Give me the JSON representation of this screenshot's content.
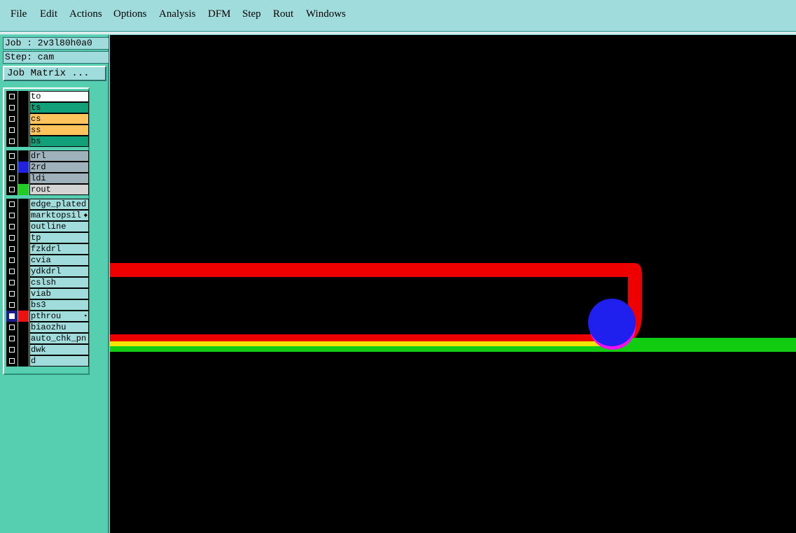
{
  "menu": [
    {
      "label": "File",
      "name": "menu-file"
    },
    {
      "label": "Edit",
      "name": "menu-edit"
    },
    {
      "label": "Actions",
      "name": "menu-actions"
    },
    {
      "label": "Options",
      "name": "menu-options"
    },
    {
      "label": "Analysis",
      "name": "menu-analysis"
    },
    {
      "label": "DFM",
      "name": "menu-dfm"
    },
    {
      "label": "Step",
      "name": "menu-step"
    },
    {
      "label": "Rout",
      "name": "menu-rout"
    },
    {
      "label": "Windows",
      "name": "menu-windows"
    }
  ],
  "job": {
    "job_text": "Job : 2v3l80h0a0",
    "step_text": "Step: cam",
    "job_matrix_label": "Job Matrix ..."
  },
  "layers": [
    {
      "name": "to",
      "bg": "#ffffff",
      "swatch": "#000000",
      "active": false,
      "mark": ""
    },
    {
      "name": "ts",
      "bg": "#12a07a",
      "swatch": "#000000",
      "active": false,
      "mark": ""
    },
    {
      "name": "cs",
      "bg": "#ffc45c",
      "swatch": "#000000",
      "active": false,
      "mark": ""
    },
    {
      "name": "ss",
      "bg": "#ffc45c",
      "swatch": "#000000",
      "active": false,
      "mark": ""
    },
    {
      "name": "bs",
      "bg": "#12a07a",
      "swatch": "#000000",
      "active": false,
      "mark": ""
    },
    {
      "name": "drl",
      "bg": "#9fb2bc",
      "swatch": "#000000",
      "active": false,
      "mark": ""
    },
    {
      "name": "2rd",
      "bg": "#9fb2bc",
      "swatch": "#2222dd",
      "active": false,
      "mark": ""
    },
    {
      "name": "ldi",
      "bg": "#9fb2bc",
      "swatch": "#000000",
      "active": false,
      "mark": ""
    },
    {
      "name": "rout",
      "bg": "#d4d4d4",
      "swatch": "#22cc22",
      "active": false,
      "mark": ""
    },
    {
      "name": "edge_plated",
      "bg": "#a0dcdc",
      "swatch": "#000000",
      "active": false,
      "mark": ""
    },
    {
      "name": "marktopsil",
      "bg": "#a0dcdc",
      "swatch": "#000000",
      "active": false,
      "mark": "◆"
    },
    {
      "name": "outline",
      "bg": "#a0dcdc",
      "swatch": "#000000",
      "active": false,
      "mark": ""
    },
    {
      "name": "tp",
      "bg": "#a0dcdc",
      "swatch": "#000000",
      "active": false,
      "mark": ""
    },
    {
      "name": "fzkdrl",
      "bg": "#a0dcdc",
      "swatch": "#000000",
      "active": false,
      "mark": ""
    },
    {
      "name": "cvia",
      "bg": "#a0dcdc",
      "swatch": "#000000",
      "active": false,
      "mark": ""
    },
    {
      "name": "ydkdrl",
      "bg": "#a0dcdc",
      "swatch": "#000000",
      "active": false,
      "mark": ""
    },
    {
      "name": "cslsh",
      "bg": "#a0dcdc",
      "swatch": "#000000",
      "active": false,
      "mark": ""
    },
    {
      "name": "viab",
      "bg": "#a0dcdc",
      "swatch": "#000000",
      "active": false,
      "mark": ""
    },
    {
      "name": "bs3",
      "bg": "#a0dcdc",
      "swatch": "#000000",
      "active": false,
      "mark": ""
    },
    {
      "name": "pthrou",
      "bg": "#a0dcdc",
      "swatch": "#ee1111",
      "active": true,
      "mark": "▪"
    },
    {
      "name": "biaozhu",
      "bg": "#a0dcdc",
      "swatch": "#000000",
      "active": false,
      "mark": ""
    },
    {
      "name": "auto_chk_pn",
      "bg": "#a0dcdc",
      "swatch": "#000000",
      "active": false,
      "mark": ""
    },
    {
      "name": "dwk",
      "bg": "#a0dcdc",
      "swatch": "#000000",
      "active": false,
      "mark": ""
    },
    {
      "name": "d",
      "bg": "#a0dcdc",
      "swatch": "#000000",
      "active": false,
      "mark": ""
    }
  ],
  "colors": {
    "red_trace": "#ee0000",
    "green_trace": "#11cc11",
    "yellow_trace": "#f2e600",
    "blue_pad": "#2020ee",
    "magenta_pad": "#ee11ee"
  }
}
